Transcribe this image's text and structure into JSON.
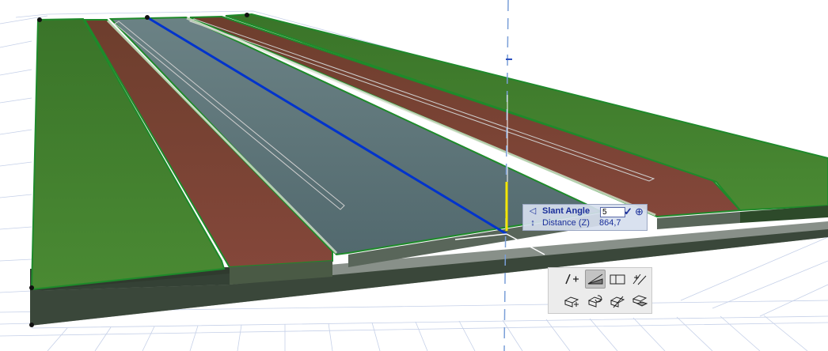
{
  "tracker": {
    "slant_angle_label": "Slant Angle",
    "slant_angle_value": "5",
    "distance_label": "Distance (Z)",
    "distance_value": "864,7",
    "slant_icon": "slant-angle-icon",
    "distance_icon": "vertical-distance-icon",
    "confirm_icon": "checkmark-icon",
    "target_icon": "crosshair-icon"
  },
  "pet_palette": {
    "buttons": [
      {
        "name": "move-node-icon",
        "active": false
      },
      {
        "name": "slant-surface-icon",
        "active": true
      },
      {
        "name": "flat-surface-icon",
        "active": false
      },
      {
        "name": "offset-edge-icon",
        "active": false
      },
      {
        "name": "drag-icon",
        "active": false
      },
      {
        "name": "rotate-icon",
        "active": false
      },
      {
        "name": "elevate-icon",
        "active": false
      },
      {
        "name": "stretch-height-icon",
        "active": false
      }
    ]
  },
  "colors": {
    "grass": "#3d7a2c",
    "brick_path": "#7a3f2f",
    "road": "#5b7478",
    "selection_outline": "#1e8a2a",
    "blue_guide": "#0033cc",
    "yellow_handle": "#f5e600",
    "grid": "#c5d0e8"
  }
}
